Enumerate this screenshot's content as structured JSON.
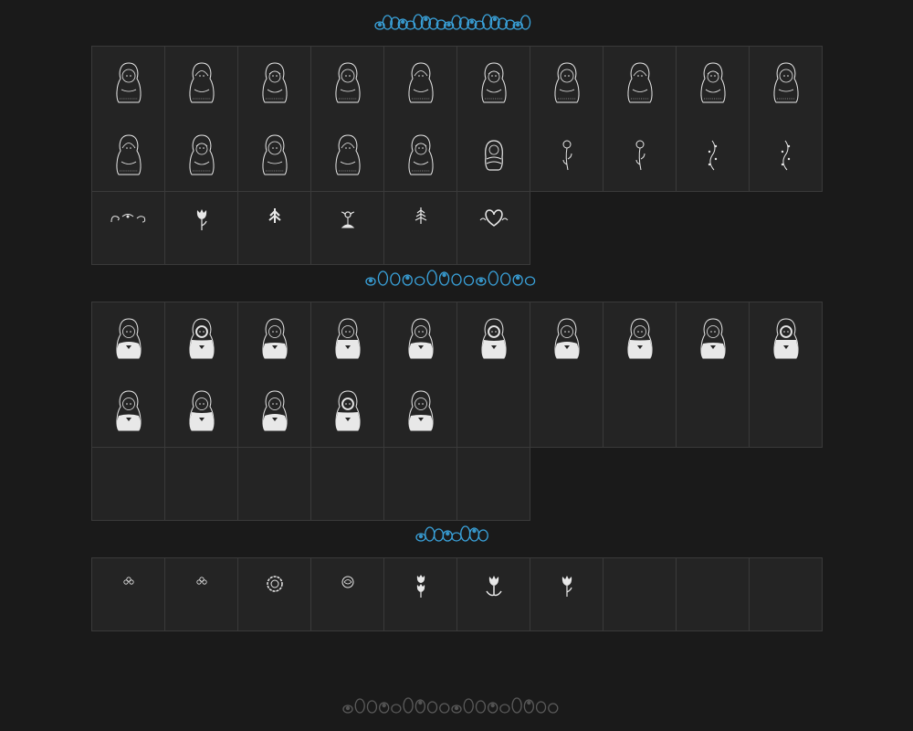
{
  "page": {
    "background_color": "#1a1a1a",
    "accent_color": "#3aa3dc",
    "cell_color": "#242424",
    "border_color": "#3a3a3a",
    "glyph_color": "#e8e8e8",
    "footer_color": "#5a5a5a"
  },
  "sections": [
    {
      "id": "outline-dolls",
      "heading_icon": "matryoshka-title-lettering-icon",
      "rows": [
        [
          "matryoshka-outline-icon",
          "matryoshka-outline-icon",
          "matryoshka-outline-icon",
          "matryoshka-outline-icon",
          "matryoshka-outline-icon",
          "matryoshka-outline-icon",
          "matryoshka-outline-icon",
          "matryoshka-outline-icon",
          "matryoshka-outline-icon",
          "matryoshka-outline-icon"
        ],
        [
          "matryoshka-outline-icon",
          "matryoshka-outline-icon",
          "matryoshka-outline-icon",
          "matryoshka-outline-icon",
          "matryoshka-outline-icon",
          "matryoshka-baby-icon",
          "flower-stem-icon",
          "flower-stem-icon",
          "vine-icon",
          "vine-icon"
        ],
        [
          "swirl-ornament-icon",
          "tulip-icon",
          "leaf-sprig-icon",
          "flower-bud-icon",
          "fern-icon",
          "heart-swirl-icon"
        ]
      ]
    },
    {
      "id": "filled-dolls",
      "heading_icon": "matryoshka-title-lettering-icon",
      "rows": [
        [
          "matryoshka-filled-icon",
          "matryoshka-filled-icon",
          "matryoshka-filled-icon",
          "matryoshka-filled-icon",
          "matryoshka-filled-icon",
          "matryoshka-filled-icon",
          "matryoshka-filled-icon",
          "matryoshka-filled-icon",
          "matryoshka-filled-icon",
          "matryoshka-filled-icon"
        ],
        [
          "matryoshka-filled-icon",
          "matryoshka-filled-icon",
          "matryoshka-filled-icon",
          "matryoshka-filled-icon",
          "matryoshka-filled-icon",
          "",
          "",
          "",
          "",
          ""
        ],
        [
          "",
          "",
          "",
          "",
          "",
          ""
        ]
      ]
    },
    {
      "id": "ornaments",
      "heading_icon": "matryoshka-title-lettering-icon",
      "rows": [
        [
          "small-flower-icon",
          "small-flower-icon",
          "ring-flower-icon",
          "rose-icon",
          "tulip-stem-icon",
          "tulip-leaf-icon",
          "tulip-icon",
          "",
          "",
          ""
        ]
      ]
    }
  ],
  "footer": {
    "icon": "matryoshka-footer-lettering-icon"
  }
}
